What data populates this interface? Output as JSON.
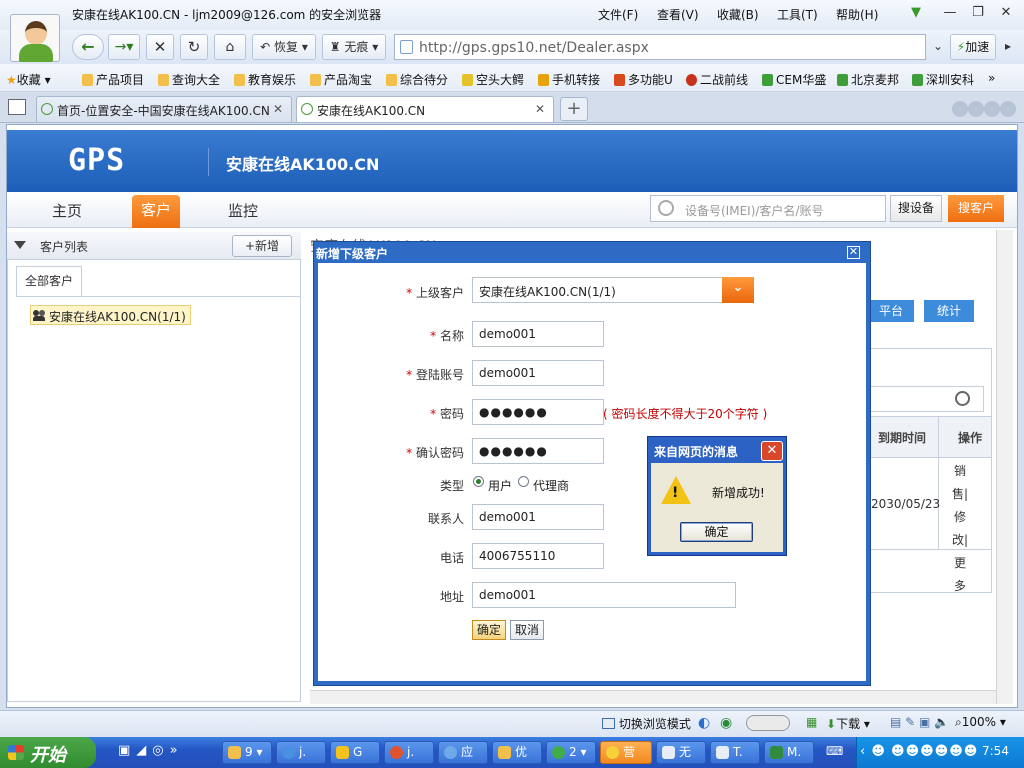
{
  "window": {
    "title": "安康在线AK100.CN - ljm2009@126.com 的安全浏览器",
    "menus": [
      "文件(F)",
      "查看(V)",
      "收藏(B)",
      "工具(T)",
      "帮助(H)"
    ]
  },
  "toolbar": {
    "restore": "恢复",
    "no_trace": "无痕",
    "url": "http://gps.gps10.net/Dealer.aspx",
    "accelerate": "加速"
  },
  "bookmarks": {
    "favorites": "收藏",
    "items": [
      "产品项目",
      "查询大全",
      "教育娱乐",
      "产品淘宝",
      "综合待分",
      "空头大鳄",
      "手机转接",
      "多功能U",
      "二战前线",
      "CEM华盛",
      "北京麦邦",
      "深圳安科"
    ],
    "more": "»"
  },
  "tabs": [
    {
      "label": "首页-位置安全-中国安康在线AK100.CN"
    },
    {
      "label": "安康在线AK100.CN"
    }
  ],
  "site": {
    "logo": "GPS",
    "title": "安康在线AK100.CN",
    "nav": [
      "主页",
      "客户",
      "监控"
    ],
    "search_placeholder": "设备号(IMEI)/客户名/账号",
    "search_device": "搜设备",
    "search_customer": "搜客户"
  },
  "left_panel": {
    "title": "客户列表",
    "new_button": "+新增",
    "tab_all": "全部客户",
    "tree_node": "安康在线AK100.CN(1/1)"
  },
  "background": {
    "title": "安康在线AK100.CN",
    "btn_platform": "平台",
    "btn_stats": "统计",
    "col_expire": "到期时间",
    "col_op": "操作",
    "expire_value": "2030/05/23",
    "ops": [
      "销",
      "售",
      "|",
      "修",
      "改",
      "|",
      "更",
      "多"
    ]
  },
  "dialog": {
    "title": "新增下级客户",
    "fields": {
      "parent": {
        "label": "上级客户",
        "value": "安康在线AK100.CN(1/1)"
      },
      "name": {
        "label": "名称",
        "value": "demo001"
      },
      "account": {
        "label": "登陆账号",
        "value": "demo001"
      },
      "password": {
        "label": "密码",
        "value": "●●●●●●",
        "hint": "( 密码长度不得大于20个字符 )"
      },
      "confirm": {
        "label": "确认密码",
        "value": "●●●●●●"
      },
      "type": {
        "label": "类型",
        "options": [
          "用户",
          "代理商"
        ],
        "selected": "用户"
      },
      "contact": {
        "label": "联系人",
        "value": "demo001"
      },
      "phone": {
        "label": "电话",
        "value": "4006755110"
      },
      "address": {
        "label": "地址",
        "value": "demo001"
      }
    },
    "required_mark": "*",
    "ok": "确定",
    "cancel": "取消"
  },
  "alert": {
    "title": "来自网页的消息",
    "message": "新增成功!",
    "ok": "确定"
  },
  "statusbar": {
    "switch_mode": "切换浏览模式",
    "download": "下载",
    "zoom": "100%"
  },
  "taskbar": {
    "start": "开始",
    "tasks": [
      "9",
      "j.",
      "G",
      "j.",
      "应",
      "优",
      "2",
      "营",
      "无",
      "T.",
      "M."
    ],
    "clock": "7:54"
  },
  "colors": {
    "accent_orange": "#ee6f12",
    "header_blue": "#1d5eb8",
    "required_red": "#d40000"
  }
}
